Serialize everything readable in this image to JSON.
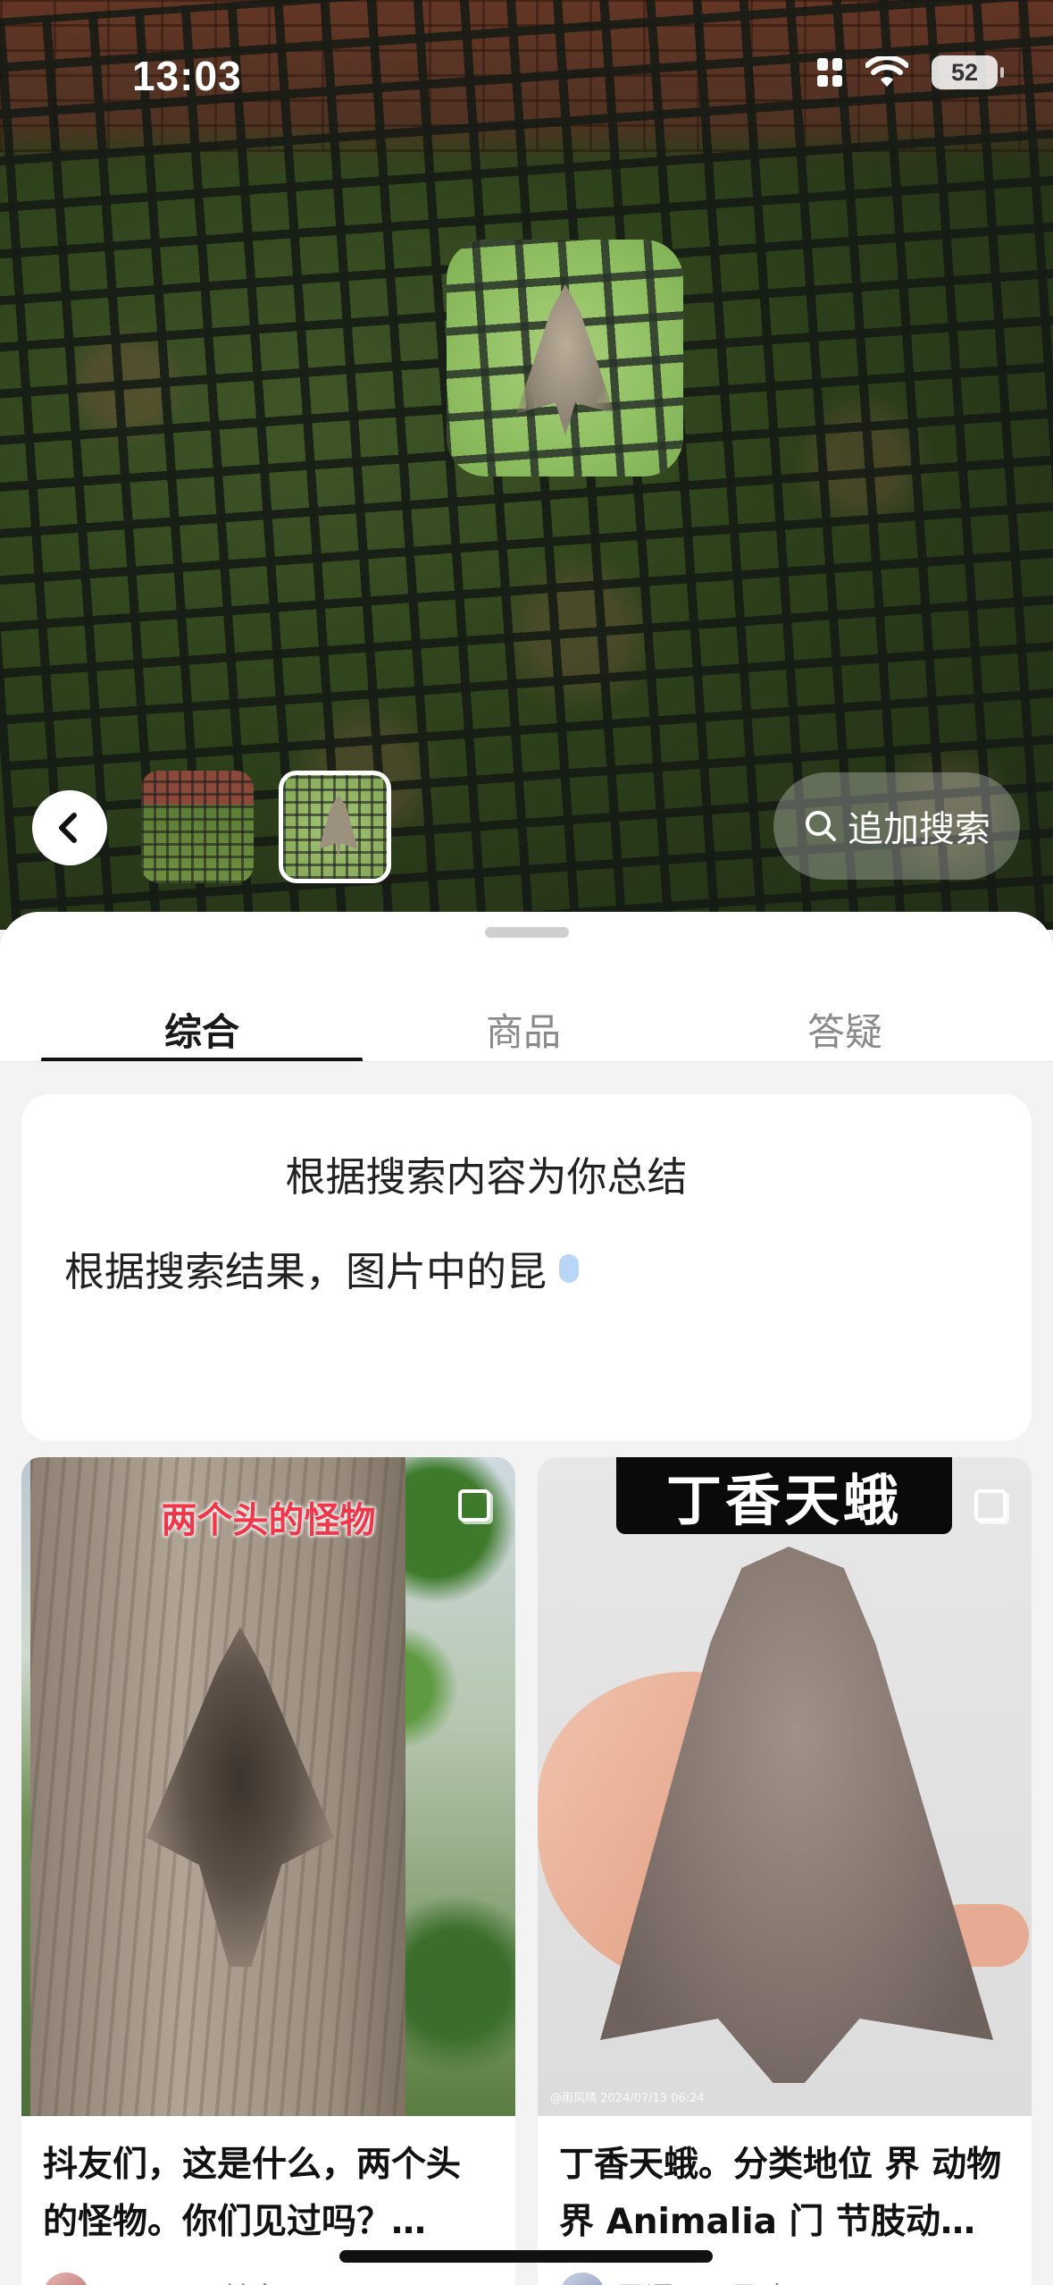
{
  "status": {
    "time": "13:03",
    "battery": "52"
  },
  "photo_toolbar": {
    "add_search_label": "追加搜索"
  },
  "tabs": [
    {
      "label": "综合",
      "active": true
    },
    {
      "label": "商品",
      "active": false
    },
    {
      "label": "答疑",
      "active": false
    }
  ],
  "summary": {
    "title": "根据搜索内容为你总结",
    "text": "根据搜索结果，图片中的昆"
  },
  "results": [
    {
      "overlay_title": "两个头的怪物",
      "text": "抖友们，这是什么，两个头的怪物。你们见过吗？…",
      "author": "(^_^) 不兰窝❤",
      "watermark": ""
    },
    {
      "overlay_title": "丁香天蛾",
      "text": "丁香天蛾。分类地位 界 动物界 Animalia 门 节肢动…",
      "author": "风语 · 雨风晴 (^_^)",
      "watermark": "@雨风晴  2024/07/13 06:24"
    }
  ],
  "icons": {
    "back": "chevron-left-icon",
    "search": "search-icon",
    "collect": "collect-icon"
  },
  "colors": {
    "overlay_red": "#f2364a",
    "active_tab_underline": "#111111",
    "typing_dot": "#b9d6f6"
  }
}
